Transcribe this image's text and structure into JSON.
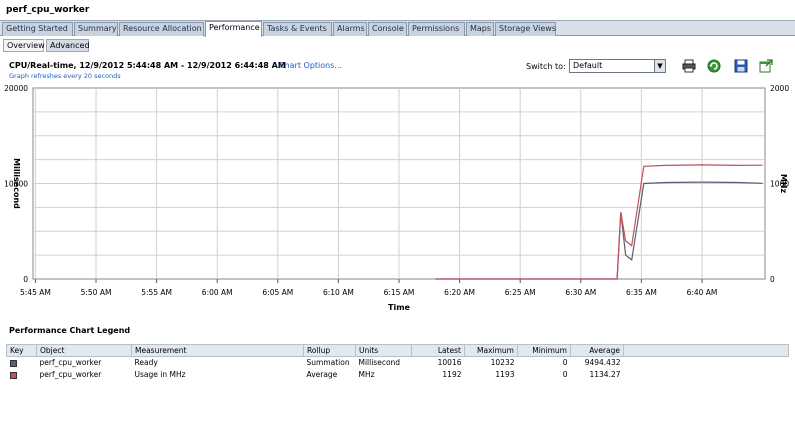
{
  "window": {
    "title": "perf_cpu_worker"
  },
  "tabs": [
    {
      "label": "Getting Started"
    },
    {
      "label": "Summary"
    },
    {
      "label": "Resource Allocation"
    },
    {
      "label": "Performance",
      "active": true
    },
    {
      "label": "Tasks & Events"
    },
    {
      "label": "Alarms"
    },
    {
      "label": "Console"
    },
    {
      "label": "Permissions"
    },
    {
      "label": "Maps"
    },
    {
      "label": "Storage Views"
    }
  ],
  "subtabs": [
    {
      "label": "Overview"
    },
    {
      "label": "Advanced",
      "active": true
    }
  ],
  "header": {
    "title": "CPU/Real-time, 12/9/2012 5:44:48 AM - 12/9/2012 6:44:48 AM",
    "chart_options": "Chart Options...",
    "refresh_note": "Graph refreshes every 20 seconds",
    "switch_label": "Switch to:",
    "switch_value": "Default"
  },
  "toolbar_icons": [
    "print-icon",
    "refresh-icon",
    "save-icon",
    "popout-icon"
  ],
  "chart_data": {
    "type": "line",
    "xlabel": "Time",
    "ylabel_left": "Millisecond",
    "ylabel_right": "MHz",
    "x_ticks": [
      "5:45 AM",
      "5:50 AM",
      "5:55 AM",
      "6:00 AM",
      "6:05 AM",
      "6:10 AM",
      "6:15 AM",
      "6:20 AM",
      "6:25 AM",
      "6:30 AM",
      "6:35 AM",
      "6:40 AM"
    ],
    "x_range_minutes": [
      0,
      60
    ],
    "y_left_ticks": [
      "0",
      "10000",
      "20000"
    ],
    "y_left_range": [
      0,
      20000
    ],
    "y_right_ticks": [
      "0",
      "1000",
      "2000"
    ],
    "y_right_range": [
      0,
      2000
    ],
    "grid": true,
    "series": [
      {
        "name": "Ready",
        "axis": "left",
        "color": "#5a5f73",
        "points": [
          [
            33,
            0
          ],
          [
            47,
            0
          ],
          [
            48,
            0
          ],
          [
            48.3,
            7000
          ],
          [
            48.7,
            2500
          ],
          [
            49.2,
            2000
          ],
          [
            50.2,
            10000
          ],
          [
            52,
            10100
          ],
          [
            55,
            10150
          ],
          [
            58,
            10100
          ],
          [
            60,
            10016
          ]
        ]
      },
      {
        "name": "Usage in MHz",
        "axis": "right",
        "color": "#c0505a",
        "points": [
          [
            33,
            0
          ],
          [
            47,
            0
          ],
          [
            48,
            0
          ],
          [
            48.3,
            700
          ],
          [
            48.7,
            400
          ],
          [
            49.2,
            350
          ],
          [
            50.2,
            1180
          ],
          [
            52,
            1190
          ],
          [
            55,
            1195
          ],
          [
            58,
            1190
          ],
          [
            60,
            1192
          ]
        ]
      }
    ]
  },
  "legend": {
    "title": "Performance Chart Legend",
    "headers": [
      "Key",
      "Object",
      "Measurement",
      "Rollup",
      "Units",
      "Latest",
      "Maximum",
      "Minimum",
      "Average"
    ],
    "rows": [
      {
        "color": "#5a5f73",
        "object": "perf_cpu_worker",
        "measurement": "Ready",
        "rollup": "Summation",
        "units": "Millisecond",
        "latest": "10016",
        "maximum": "10232",
        "minimum": "0",
        "average": "9494.432"
      },
      {
        "color": "#c0505a",
        "object": "perf_cpu_worker",
        "measurement": "Usage in MHz",
        "rollup": "Average",
        "units": "MHz",
        "latest": "1192",
        "maximum": "1193",
        "minimum": "0",
        "average": "1134.27"
      }
    ]
  }
}
